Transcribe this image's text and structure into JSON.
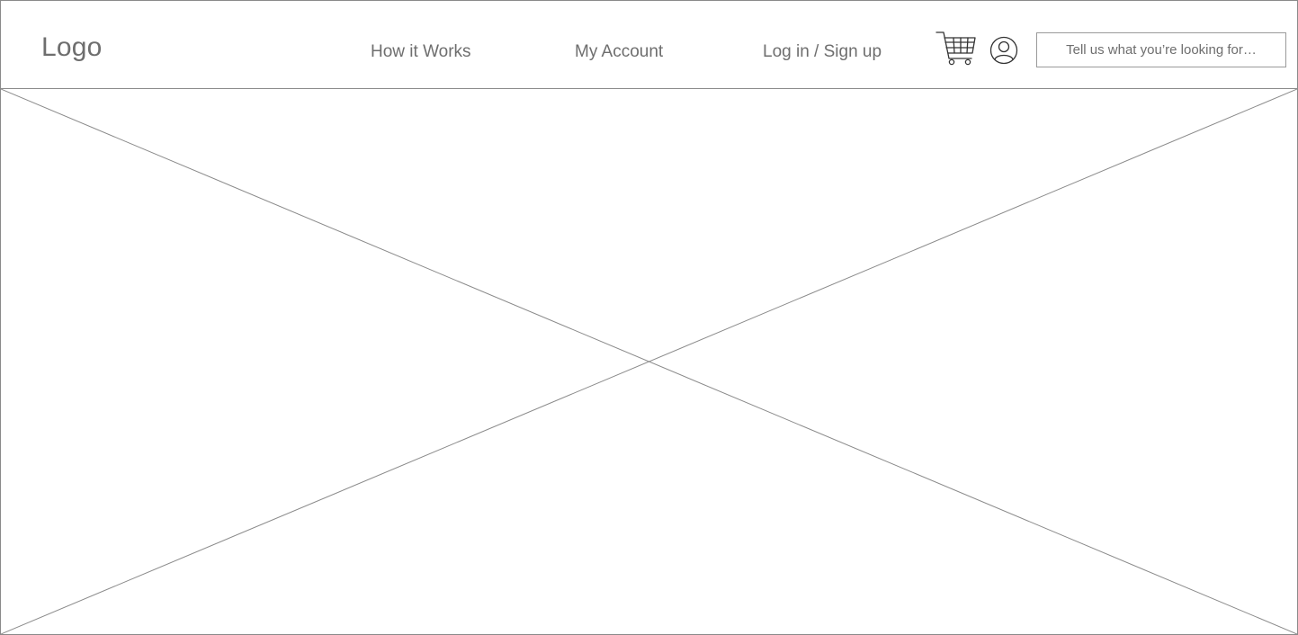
{
  "header": {
    "logo_text": "Logo",
    "nav": {
      "how_it_works": "How it Works",
      "my_account": "My Account",
      "login_signup": "Log in / Sign up"
    },
    "icons": {
      "cart": "shopping-cart-icon",
      "user": "user-icon"
    },
    "search": {
      "placeholder": "Tell us what you’re looking for…",
      "value": ""
    }
  },
  "hero": {
    "type": "image-placeholder"
  },
  "colors": {
    "line": "#8a8a8a",
    "text": "#6e6e6e",
    "background": "#ffffff"
  }
}
